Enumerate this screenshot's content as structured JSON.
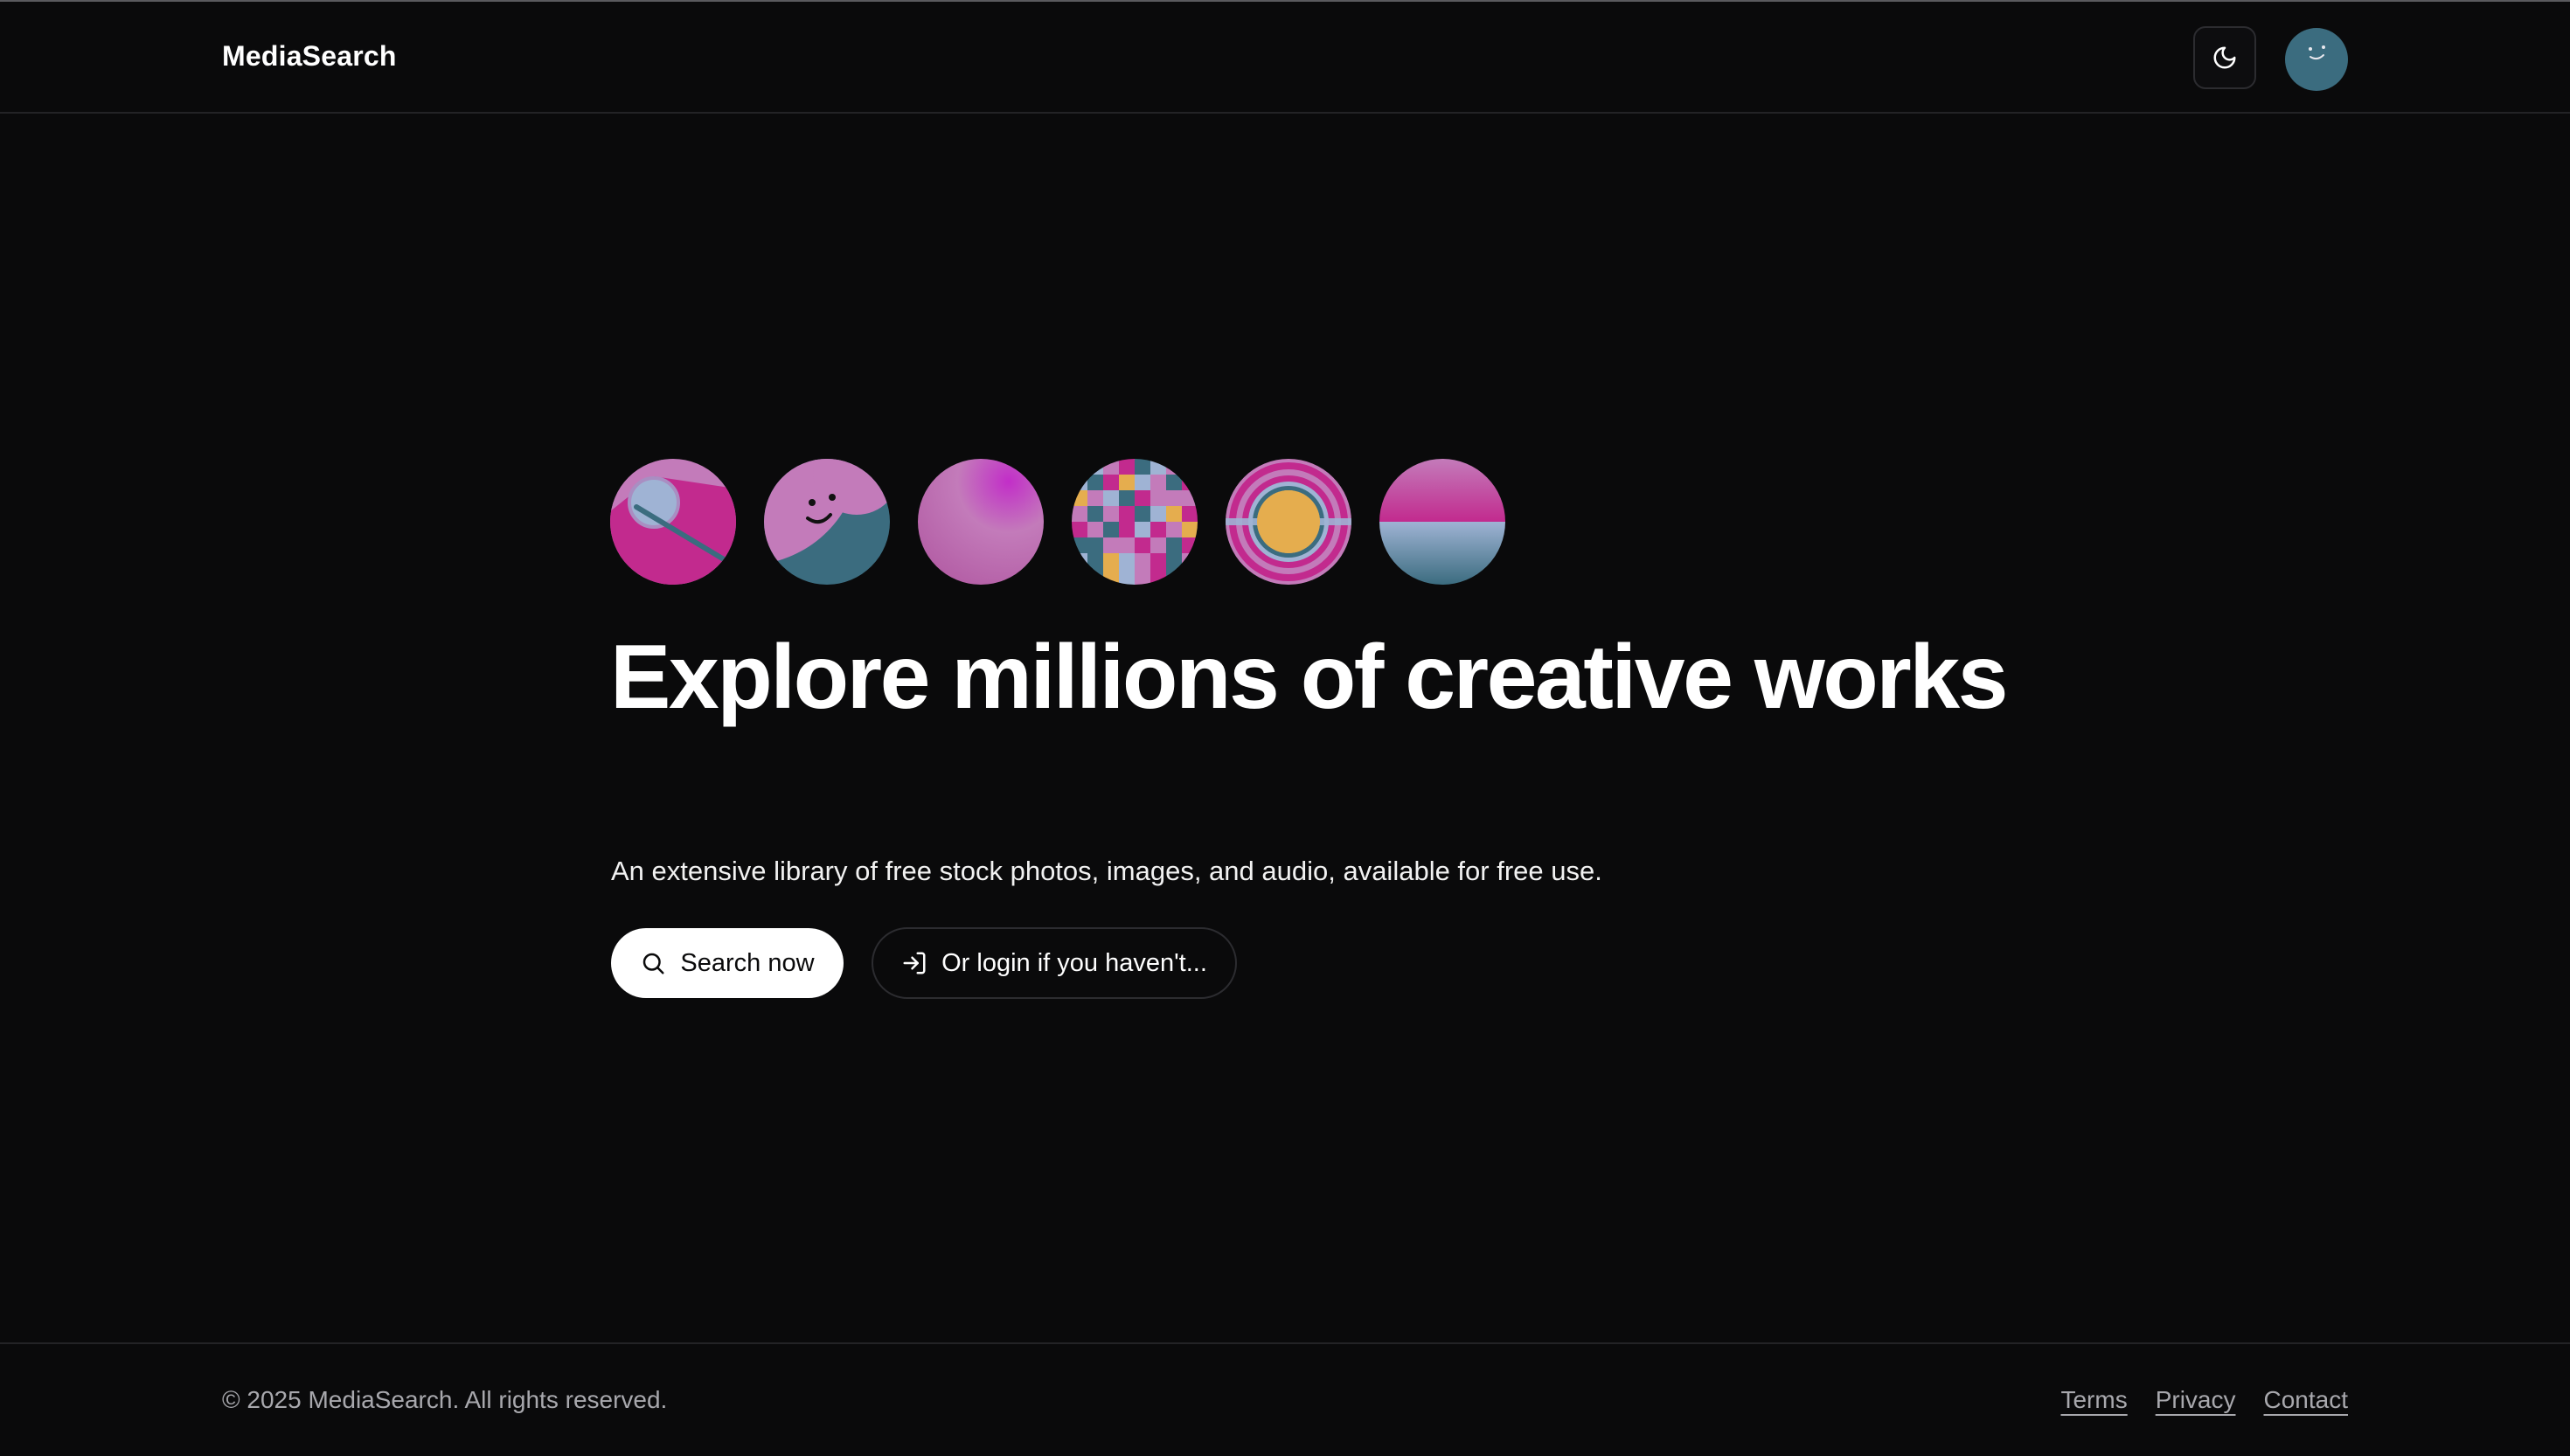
{
  "header": {
    "brand": "MediaSearch",
    "theme_toggle_icon": "moon-icon",
    "avatar_icon": "smiley-avatar"
  },
  "hero": {
    "thumbnails": [
      "magnifier-art",
      "smiley-art",
      "gradient-orb-art",
      "pixel-mosaic-art",
      "concentric-rings-art",
      "horizon-art"
    ],
    "title": "Explore millions of creative works",
    "subtitle": "An extensive library of free stock photos, images, and audio, available for free use.",
    "primary_button": {
      "label": "Search now",
      "icon": "search-icon"
    },
    "secondary_button": {
      "label": "Or login if you haven't...",
      "icon": "login-icon"
    }
  },
  "footer": {
    "copyright": "© 2025 MediaSearch. All rights reserved.",
    "links": [
      "Terms",
      "Privacy",
      "Contact"
    ]
  },
  "colors": {
    "background": "#0a0a0b",
    "magenta": "#c22a8e",
    "pink": "#c37bba",
    "teal": "#3b6c7f",
    "light_blue": "#9fb3d4",
    "amber": "#e5ad4e"
  }
}
